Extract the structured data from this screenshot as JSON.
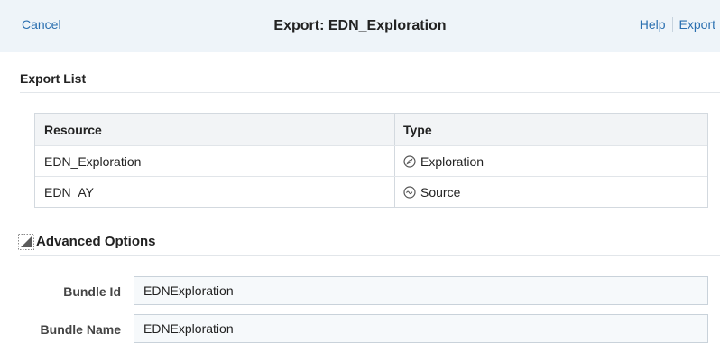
{
  "header": {
    "cancel_label": "Cancel",
    "title": "Export: EDN_Exploration",
    "help_label": "Help",
    "export_label": "Export"
  },
  "export_list": {
    "title": "Export List",
    "columns": [
      "Resource",
      "Type"
    ],
    "rows": [
      {
        "resource": "EDN_Exploration",
        "type": "Exploration",
        "icon": "compass-icon"
      },
      {
        "resource": "EDN_AY",
        "type": "Source",
        "icon": "wave-icon"
      }
    ]
  },
  "advanced_options": {
    "title": "Advanced Options",
    "expanded": true,
    "fields": [
      {
        "label": "Bundle Id",
        "value": "EDNExploration"
      },
      {
        "label": "Bundle Name",
        "value": "EDNExploration"
      }
    ]
  },
  "colors": {
    "link": "#2a6fb0",
    "header_bg": "#eef4f9"
  }
}
